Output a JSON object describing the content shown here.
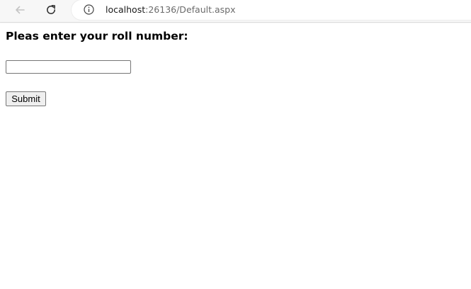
{
  "browser": {
    "url_host": "localhost",
    "url_path": ":26136/Default.aspx",
    "icons": {
      "back": "back-arrow-icon",
      "reload": "reload-icon",
      "site_info": "info-icon"
    }
  },
  "form": {
    "heading": "Pleas enter your roll number:",
    "roll_input": {
      "value": "",
      "placeholder": ""
    },
    "submit_label": "Submit"
  }
}
